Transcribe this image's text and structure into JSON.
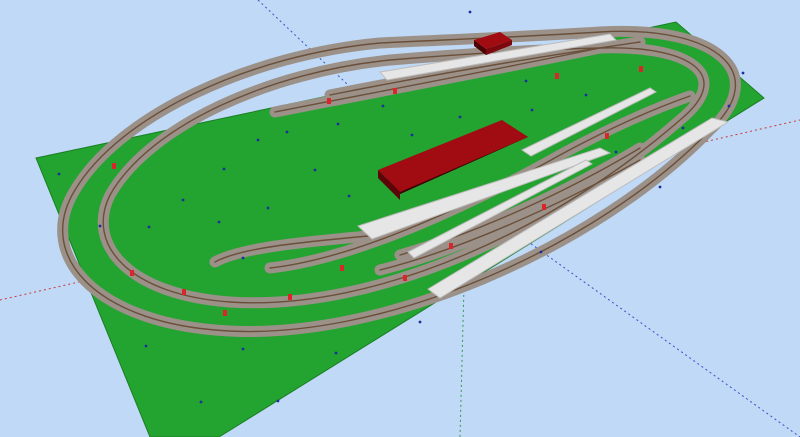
{
  "scene": {
    "background_color": "#bfd9f6",
    "baseboard_color": "#23a32f",
    "track_ballast_color": "#9b9189",
    "track_rail_color": "#6a4f3a",
    "tie_marker_color": "#d8262a",
    "platform_color": "#e6e6e6",
    "roof_color": "#8c0b0f",
    "marker_dot_color": "#1b2f9c",
    "axis_colors": {
      "x_axis": "#cc3a3a",
      "y_axis": "#2f9a4a",
      "z_axis": "#3a52cc"
    },
    "icons": [
      "station-building",
      "small-station-building"
    ]
  }
}
